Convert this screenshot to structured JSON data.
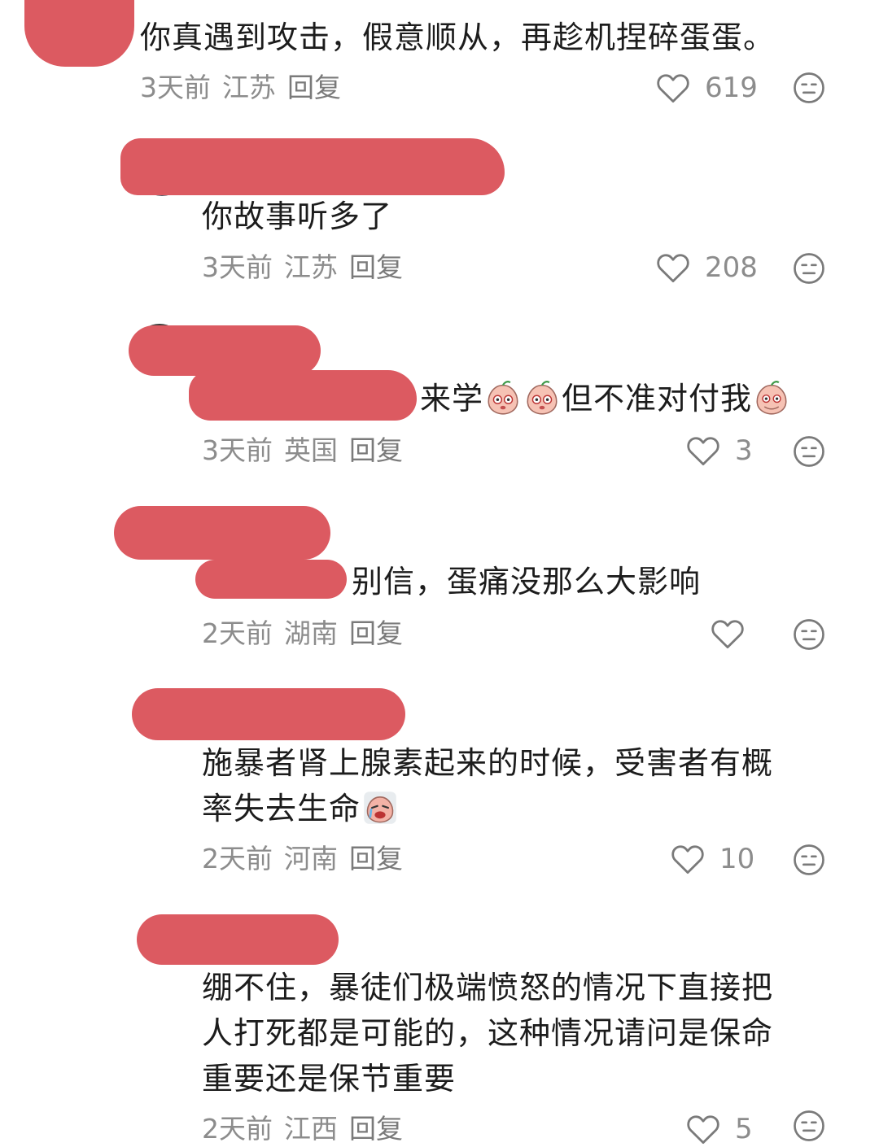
{
  "comments": [
    {
      "text": "你真遇到攻击，假意顺从，再趁机捏碎蛋蛋。",
      "time": "3天前",
      "location": "江苏",
      "reply": "回复",
      "likes": "619"
    },
    {
      "text": "你故事听多了",
      "time": "3天前",
      "location": "江苏",
      "reply": "回复",
      "likes": "208"
    },
    {
      "text_a": "来学",
      "text_b": "但不准对付我",
      "time": "3天前",
      "location": "英国",
      "reply": "回复",
      "likes": "3"
    },
    {
      "text": "别信，蛋痛没那么大影响",
      "time": "2天前",
      "location": "湖南",
      "reply": "回复",
      "likes": ""
    },
    {
      "line1": "施暴者肾上腺素起来的时候，受害者有概",
      "line2": "率失去生命",
      "time": "2天前",
      "location": "河南",
      "reply": "回复",
      "likes": "10"
    },
    {
      "line1": "绷不住，暴徒们极端愤怒的情况下直接把",
      "line2": "人打死都是可能的，这种情况请问是保命",
      "line3": "重要还是保节重要",
      "time": "2天前",
      "location": "江西",
      "reply": "回复",
      "likes": "5"
    }
  ],
  "icons": {
    "like": "heart-outline-icon",
    "dislike": "meh-face-icon",
    "emoji_peach": "peach-emoji-icon",
    "emoji_cry": "crying-emoji-icon"
  },
  "colors": {
    "redaction": "#dc5a61",
    "meta_text": "#8c8c8c",
    "body_text": "#1c1c1c"
  }
}
